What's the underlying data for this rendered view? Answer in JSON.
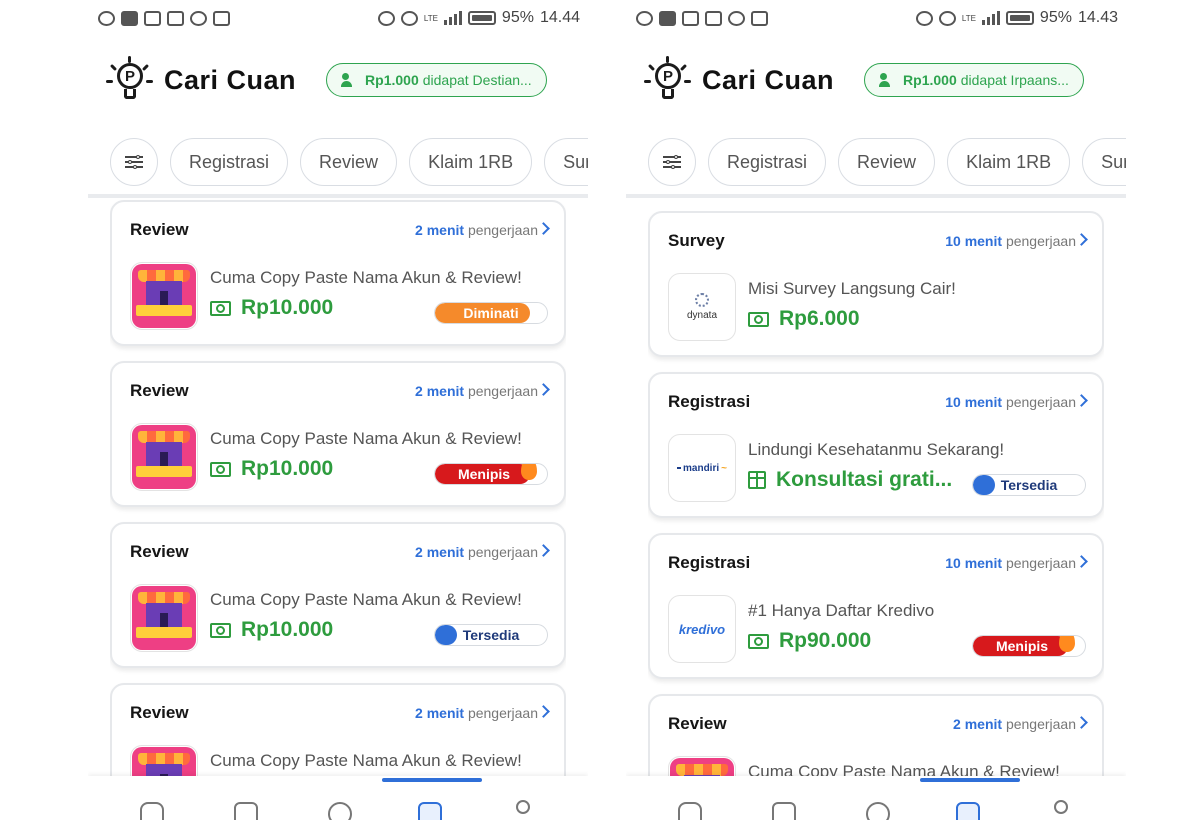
{
  "phones": [
    {
      "status": {
        "battery": "95%",
        "time": "14.44",
        "net": "LTE"
      },
      "app_title": "Cari Cuan",
      "earn": {
        "amount": "Rp1.000",
        "text": "didapat Destian..."
      },
      "filters": [
        "Registrasi",
        "Review",
        "Klaim 1RB",
        "Survey"
      ],
      "tasks": [
        {
          "category": "Review",
          "minutes": "2 menit",
          "suffix": "pengerjaan",
          "title": "Cuma Copy Paste Nama Akun & Review!",
          "reward": "Rp10.000",
          "reward_icon": "money-icon",
          "thumb": "shop",
          "badge": "Diminati",
          "badge_type": "diminati",
          "badge_level": 0.85
        },
        {
          "category": "Review",
          "minutes": "2 menit",
          "suffix": "pengerjaan",
          "title": "Cuma Copy Paste Nama Akun & Review!",
          "reward": "Rp10.000",
          "reward_icon": "money-icon",
          "thumb": "shop",
          "badge": "Menipis",
          "badge_type": "menipis",
          "badge_level": 0.85
        },
        {
          "category": "Review",
          "minutes": "2 menit",
          "suffix": "pengerjaan",
          "title": "Cuma Copy Paste Nama Akun & Review!",
          "reward": "Rp10.000",
          "reward_icon": "money-icon",
          "thumb": "shop",
          "badge": "Tersedia",
          "badge_type": "tersedia",
          "badge_level": 0.2
        },
        {
          "category": "Review",
          "minutes": "2 menit",
          "suffix": "pengerjaan",
          "title": "Cuma Copy Paste Nama Akun & Review!",
          "reward": "",
          "reward_icon": "money-icon",
          "thumb": "shop",
          "badge": "",
          "badge_type": "",
          "badge_level": 0
        }
      ]
    },
    {
      "status": {
        "battery": "95%",
        "time": "14.43",
        "net": "LTE"
      },
      "app_title": "Cari Cuan",
      "earn": {
        "amount": "Rp1.000",
        "text": "didapat Irpaans..."
      },
      "filters": [
        "Registrasi",
        "Review",
        "Klaim 1RB",
        "Survey"
      ],
      "tasks": [
        {
          "category": "Survey",
          "minutes": "10 menit",
          "suffix": "pengerjaan",
          "title": "Misi Survey Langsung Cair!",
          "reward": "Rp6.000",
          "reward_icon": "money-icon",
          "thumb": "dynata",
          "thumb_text": "dynata",
          "badge": "",
          "badge_type": "",
          "badge_level": 0
        },
        {
          "category": "Registrasi",
          "minutes": "10 menit",
          "suffix": "pengerjaan",
          "title": "Lindungi Kesehatanmu Sekarang!",
          "reward": "Konsultasi grati...",
          "reward_icon": "gift-icon",
          "thumb": "mandiri",
          "thumb_text": "mandiri",
          "badge": "Tersedia",
          "badge_type": "tersedia",
          "badge_level": 0.2
        },
        {
          "category": "Registrasi",
          "minutes": "10 menit",
          "suffix": "pengerjaan",
          "title": "#1 Hanya Daftar Kredivo",
          "reward": "Rp90.000",
          "reward_icon": "money-icon",
          "thumb": "kredivo",
          "thumb_text": "kredivo",
          "badge": "Menipis",
          "badge_type": "menipis",
          "badge_level": 0.85
        },
        {
          "category": "Review",
          "minutes": "2 menit",
          "suffix": "pengerjaan",
          "title": "Cuma Copy Paste Nama Akun & Review!",
          "reward": "",
          "reward_icon": "money-icon",
          "thumb": "shop",
          "badge": "",
          "badge_type": "",
          "badge_level": 0
        }
      ]
    }
  ],
  "nav": [
    "home-icon",
    "tasks-icon",
    "chat-icon",
    "cuan-icon",
    "profile-icon"
  ],
  "nav_active": 3,
  "colors": {
    "accent": "#2f6fd8",
    "green": "#2e9c3e",
    "orange": "#f58a2b",
    "red": "#d7191c"
  }
}
